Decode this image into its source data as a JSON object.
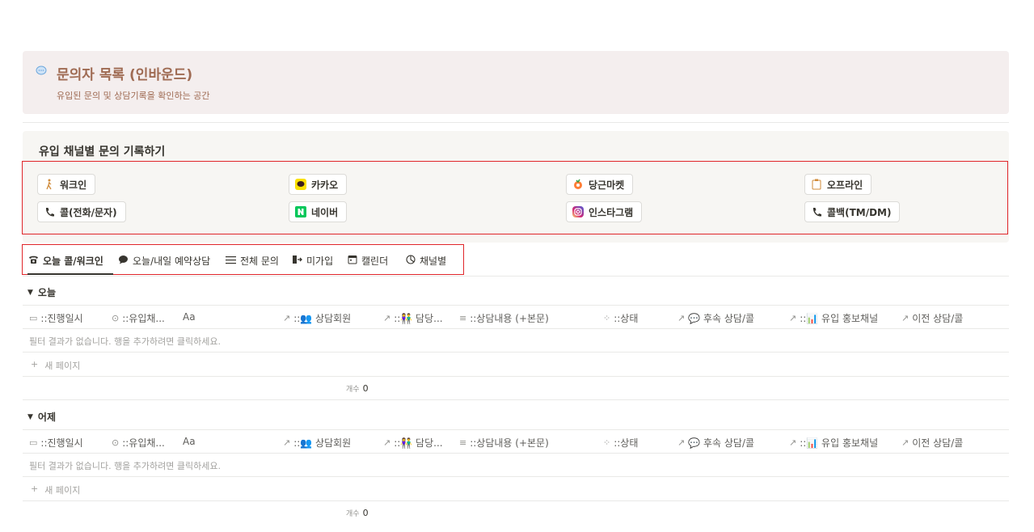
{
  "callout": {
    "icon": "speech-bubble-icon",
    "title": "문의자 목록 (인바운드)",
    "subtitle": "유입된 문의 및 상담기록을 확인하는 공간"
  },
  "channels": {
    "title": "유입 채널별 문의 기록하기",
    "buttons": [
      {
        "label": "워크인",
        "icon": "walking-person-icon"
      },
      {
        "label": "카카오",
        "icon": "kakao-talk-icon",
        "color": "#fae100"
      },
      {
        "label": "당근마켓",
        "icon": "carrot-icon",
        "color": "#ff7e36"
      },
      {
        "label": "오프라인",
        "icon": "clipboard-icon"
      },
      {
        "label": "콜(전화/문자)",
        "icon": "phone-icon"
      },
      {
        "label": "네이버",
        "icon": "naver-icon",
        "color": "#03c75a"
      },
      {
        "label": "인스타그램",
        "icon": "instagram-icon",
        "color": "#d62976"
      },
      {
        "label": "콜백(TM/DM)",
        "icon": "phone-icon"
      }
    ]
  },
  "tabs": [
    {
      "label": "오늘 콜/워크인",
      "icon": "telephone-icon",
      "active": true
    },
    {
      "label": "오늘/내일 예약상담",
      "icon": "chat-bubble-icon"
    },
    {
      "label": "전체 문의",
      "icon": "list-icon"
    },
    {
      "label": "미가입",
      "icon": "exit-door-icon"
    },
    {
      "label": "캘린더",
      "icon": "calendar-icon"
    },
    {
      "label": "채널별",
      "icon": "pie-chart-icon"
    }
  ],
  "columns": [
    {
      "label": "::진행일시",
      "icon": "calendar-icon"
    },
    {
      "label": "::유입채...",
      "icon": "select-circle-icon"
    },
    {
      "label": "Aa",
      "icon": ""
    },
    {
      "label": "::👥 상담회원",
      "icon": "relation-arrow-icon"
    },
    {
      "label": "::👫 담당...",
      "icon": "relation-arrow-icon"
    },
    {
      "label": "::상담내용 (+본문)",
      "icon": "text-lines-icon"
    },
    {
      "label": "::상태",
      "icon": "status-spinner-icon"
    },
    {
      "label": "💬 후속 상담/콜",
      "icon": "relation-arrow-icon"
    },
    {
      "label": "::📊 유입 홍보채널",
      "icon": "relation-arrow-icon"
    },
    {
      "label": "이전 상담/콜",
      "icon": "relation-arrow-icon"
    }
  ],
  "groups": [
    {
      "name": "오늘",
      "empty_text": "필터 결과가 없습니다. 행을 추가하려면 클릭하세요.",
      "new_page": "새 페이지",
      "count_label": "개수",
      "count": "0"
    },
    {
      "name": "어제",
      "empty_text": "필터 결과가 없습니다. 행을 추가하려면 클릭하세요.",
      "new_page": "새 페이지",
      "count_label": "개수",
      "count": "0"
    }
  ]
}
